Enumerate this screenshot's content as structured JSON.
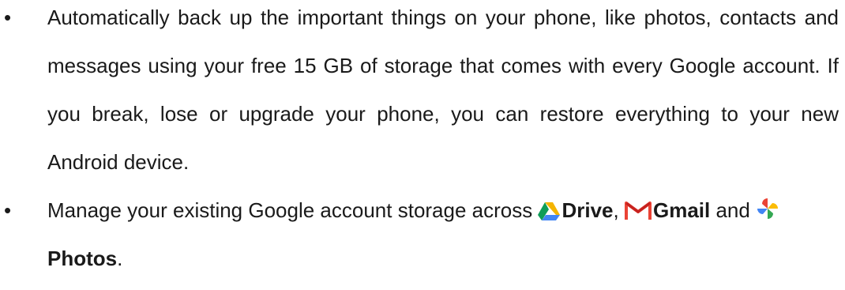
{
  "bullets": [
    {
      "bullet": "•",
      "text": "Automatically back up the important things on your phone, like photos, contacts and messages using your free 15 GB of storage that comes with every Google account. If you break, lose or upgrade your phone, you can restore everything to your new Android device."
    },
    {
      "bullet": "•",
      "text_before": "Manage your existing Google account storage across ",
      "drive_label": "Drive",
      "comma": ",",
      "gmail_label": "Gmail",
      "and_text": " and ",
      "photos_label": "Photos",
      "period": ".",
      "icons": [
        "google-drive-icon",
        "gmail-icon",
        "google-photos-icon"
      ]
    }
  ],
  "colors": {
    "text": "#1a1a1a",
    "drive_green": "#0f9d58",
    "drive_yellow": "#f4b400",
    "drive_blue": "#4285f4",
    "gmail_red": "#ea4335",
    "photos_red": "#ea4335",
    "photos_yellow": "#fbbc05",
    "photos_green": "#34a853",
    "photos_blue": "#4285f4"
  }
}
